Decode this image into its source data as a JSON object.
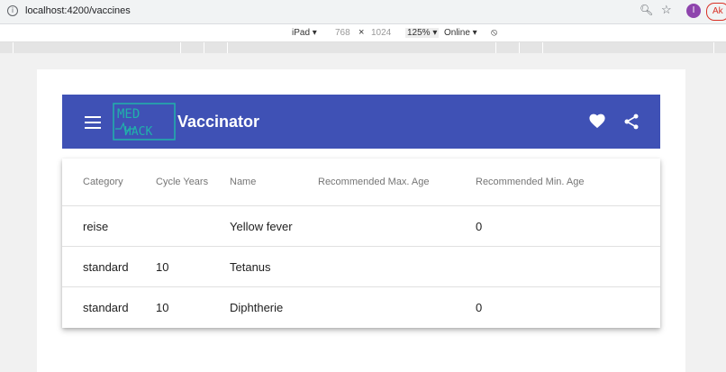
{
  "browser": {
    "url": "localhost:4200/vaccines",
    "profile_initial": "I",
    "ak_label": "Ak"
  },
  "devtools": {
    "device": "iPad ▾",
    "width": "768",
    "times": "×",
    "height": "1024",
    "zoom": "125% ▾",
    "network": "Online ▾"
  },
  "app": {
    "title": "Vaccinator",
    "logo_text_top": "MED",
    "logo_text_bottom": "HACK",
    "accent": "#3f51b5"
  },
  "table": {
    "headers": [
      "Category",
      "Cycle Years",
      "Name",
      "Recommended Max. Age",
      "Recommended Min. Age"
    ],
    "rows": [
      [
        "reise",
        "",
        "Yellow fever",
        "",
        "0"
      ],
      [
        "standard",
        "10",
        "Tetanus",
        "",
        ""
      ],
      [
        "standard",
        "10",
        "Diphtherie",
        "",
        "0"
      ]
    ]
  }
}
